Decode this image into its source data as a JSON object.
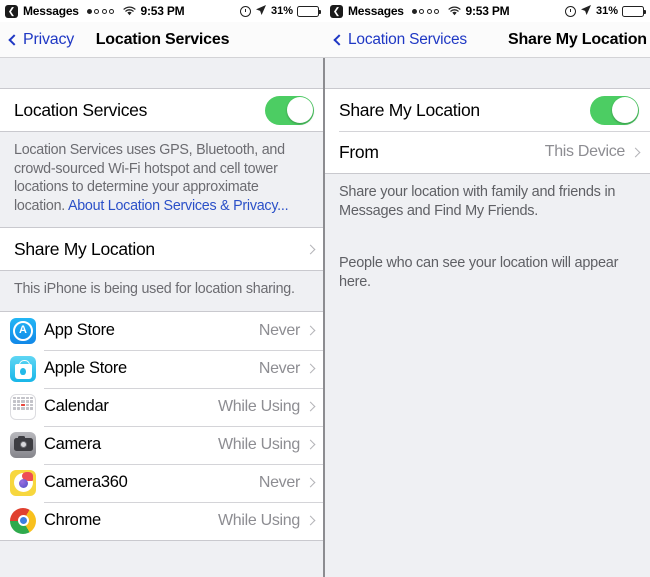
{
  "status_bar": {
    "back_badge_icon": "back-arrow-badge-icon",
    "carrier_label": "Messages",
    "signal_dots_filled": 1,
    "signal_dots_total": 5,
    "wifi_icon": "wifi-icon",
    "time": "9:53 PM",
    "alarm_icon": "alarm-clock-icon",
    "location_arrow_icon": "location-arrow-icon",
    "battery_percent": "31%",
    "battery_icon": "battery-icon"
  },
  "left_panel": {
    "nav": {
      "back_label": "Privacy",
      "title": "Location Services",
      "back_chevron_icon": "chevron-left-icon"
    },
    "master_switch": {
      "label": "Location Services",
      "enabled": true
    },
    "master_note": {
      "text": "Location Services uses GPS, Bluetooth, and crowd-sourced Wi-Fi hotspot and cell tower locations to determine your approximate location. ",
      "link": "About Location Services & Privacy..."
    },
    "share_row": {
      "label": "Share My Location",
      "chevron_icon": "chevron-right-icon"
    },
    "share_note": "This iPhone is being used for location sharing.",
    "apps": [
      {
        "name": "App Store",
        "permission": "Never",
        "icon": "app-store-icon"
      },
      {
        "name": "Apple Store",
        "permission": "Never",
        "icon": "apple-store-icon"
      },
      {
        "name": "Calendar",
        "permission": "While Using",
        "icon": "calendar-icon"
      },
      {
        "name": "Camera",
        "permission": "While Using",
        "icon": "camera-icon"
      },
      {
        "name": "Camera360",
        "permission": "Never",
        "icon": "camera360-icon"
      },
      {
        "name": "Chrome",
        "permission": "While Using",
        "icon": "chrome-icon"
      }
    ]
  },
  "right_panel": {
    "nav": {
      "back_label": "Location Services",
      "title": "Share My Location",
      "back_chevron_icon": "chevron-left-icon"
    },
    "share_switch": {
      "label": "Share My Location",
      "enabled": true
    },
    "from_row": {
      "label": "From",
      "value": "This Device",
      "chevron_icon": "chevron-right-icon"
    },
    "from_note": "Share your location with family and friends in Messages and Find My Friends.",
    "people_note": "People who can see your location will appear here."
  },
  "colors": {
    "toggle_on": "#4ccd63",
    "link_blue": "#2b50c8",
    "nav_blue": "#1f38c4",
    "value_gray": "#8d8d92"
  }
}
